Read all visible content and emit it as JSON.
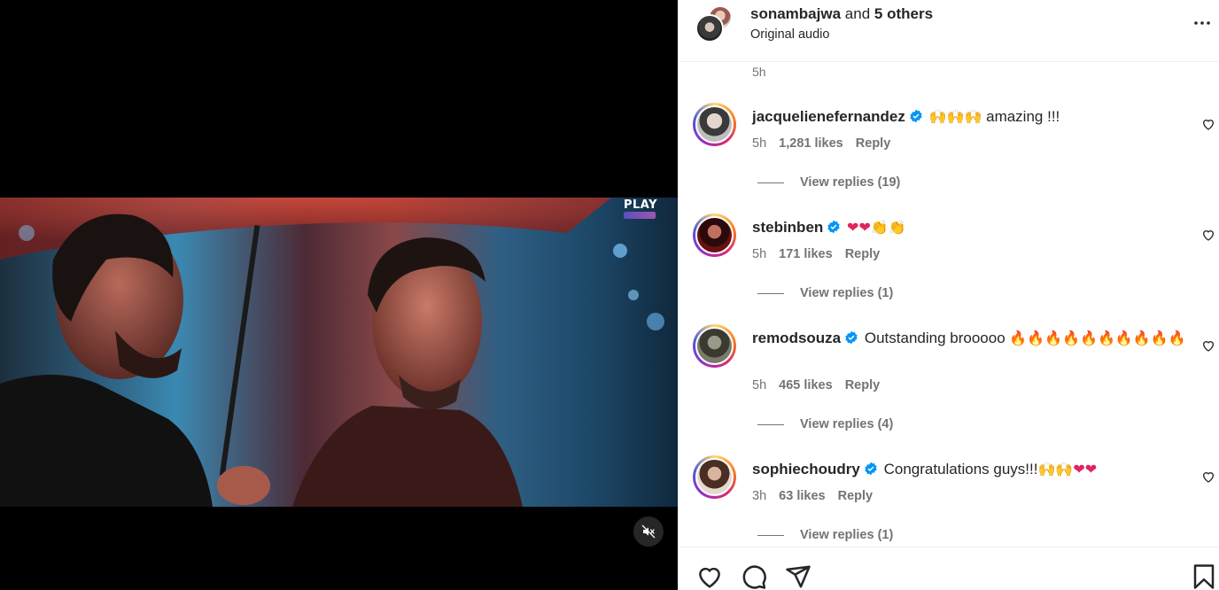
{
  "media": {
    "watermark": "PLAY",
    "mute_icon": "speaker-muted-icon"
  },
  "header": {
    "username": "sonambajwa",
    "joiner": "and",
    "others": "5 others",
    "audio": "Original audio",
    "more_icon": "more-horizontal-icon"
  },
  "caption": {
    "time": "5h"
  },
  "comments": [
    {
      "user": "jacquelienefernandez",
      "verified": true,
      "emoji": "🙌🙌🙌",
      "text": " amazing !!!",
      "text2": "",
      "time": "5h",
      "likes": "1,281 likes",
      "reply": "Reply",
      "view_replies": "View replies (19)"
    },
    {
      "user": "stebinben",
      "verified": true,
      "emoji": "❤❤👏👏",
      "text": "",
      "text2": "",
      "time": "5h",
      "likes": "171 likes",
      "reply": "Reply",
      "view_replies": "View replies (1)"
    },
    {
      "user": "remodsouza",
      "verified": true,
      "emoji": "",
      "text": "Outstanding brooooo ",
      "text2": "🔥🔥🔥🔥🔥🔥🔥🔥🔥🔥",
      "time": "5h",
      "likes": "465 likes",
      "reply": "Reply",
      "view_replies": "View replies (4)"
    },
    {
      "user": "sophiechoudry",
      "verified": true,
      "emoji": "",
      "text": "Congratulations guys!!!",
      "text2": "🙌🙌❤❤",
      "time": "3h",
      "likes": "63 likes",
      "reply": "Reply",
      "view_replies": "View replies (1)"
    }
  ],
  "actions": {
    "like_icon": "heart-icon",
    "comment_icon": "comment-icon",
    "share_icon": "send-icon",
    "save_icon": "bookmark-icon"
  },
  "colors": {
    "verified": "#0095f6",
    "muted_text": "#737373",
    "text": "#262626"
  }
}
